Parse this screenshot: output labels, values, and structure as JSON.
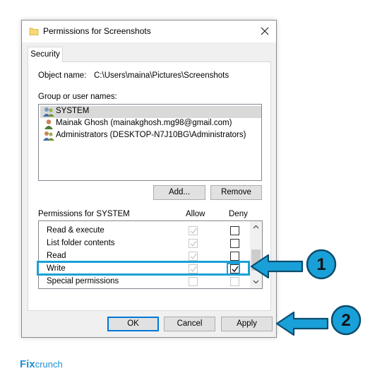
{
  "window": {
    "title": "Permissions for Screenshots",
    "icons": {
      "title": "folder-icon",
      "close": "close-icon"
    }
  },
  "tabs": [
    {
      "label": "Security"
    }
  ],
  "object": {
    "label": "Object name:",
    "path": "C:\\Users\\maina\\Pictures\\Screenshots"
  },
  "groups": {
    "label": "Group or user names:",
    "items": [
      {
        "name": "SYSTEM",
        "icon": "users-icon",
        "selected": true
      },
      {
        "name": "Mainak Ghosh (mainakghosh.mg98@gmail.com)",
        "icon": "user-icon",
        "selected": false
      },
      {
        "name": "Administrators (DESKTOP-N7J10BG\\Administrators)",
        "icon": "users-icon",
        "selected": false
      }
    ],
    "add_label": "Add...",
    "remove_label": "Remove"
  },
  "permissions": {
    "label": "Permissions for SYSTEM",
    "allow_header": "Allow",
    "deny_header": "Deny",
    "rows": [
      {
        "name": "Read & execute",
        "allow": true,
        "deny": false
      },
      {
        "name": "List folder contents",
        "allow": true,
        "deny": false
      },
      {
        "name": "Read",
        "allow": true,
        "deny": false
      },
      {
        "name": "Write",
        "allow": true,
        "deny": true
      },
      {
        "name": "Special permissions",
        "allow": false,
        "deny": false
      }
    ]
  },
  "footer": {
    "ok_label": "OK",
    "cancel_label": "Cancel",
    "apply_label": "Apply"
  },
  "annotations": {
    "step1": "1",
    "step2": "2",
    "color": "#1aa0d8"
  },
  "brand": {
    "fix": "Fix",
    "crunch": "crunch"
  },
  "colors": {
    "accent": "#0078d7",
    "selection": "#d9d9d9",
    "highlight": "#1aa0d8"
  }
}
